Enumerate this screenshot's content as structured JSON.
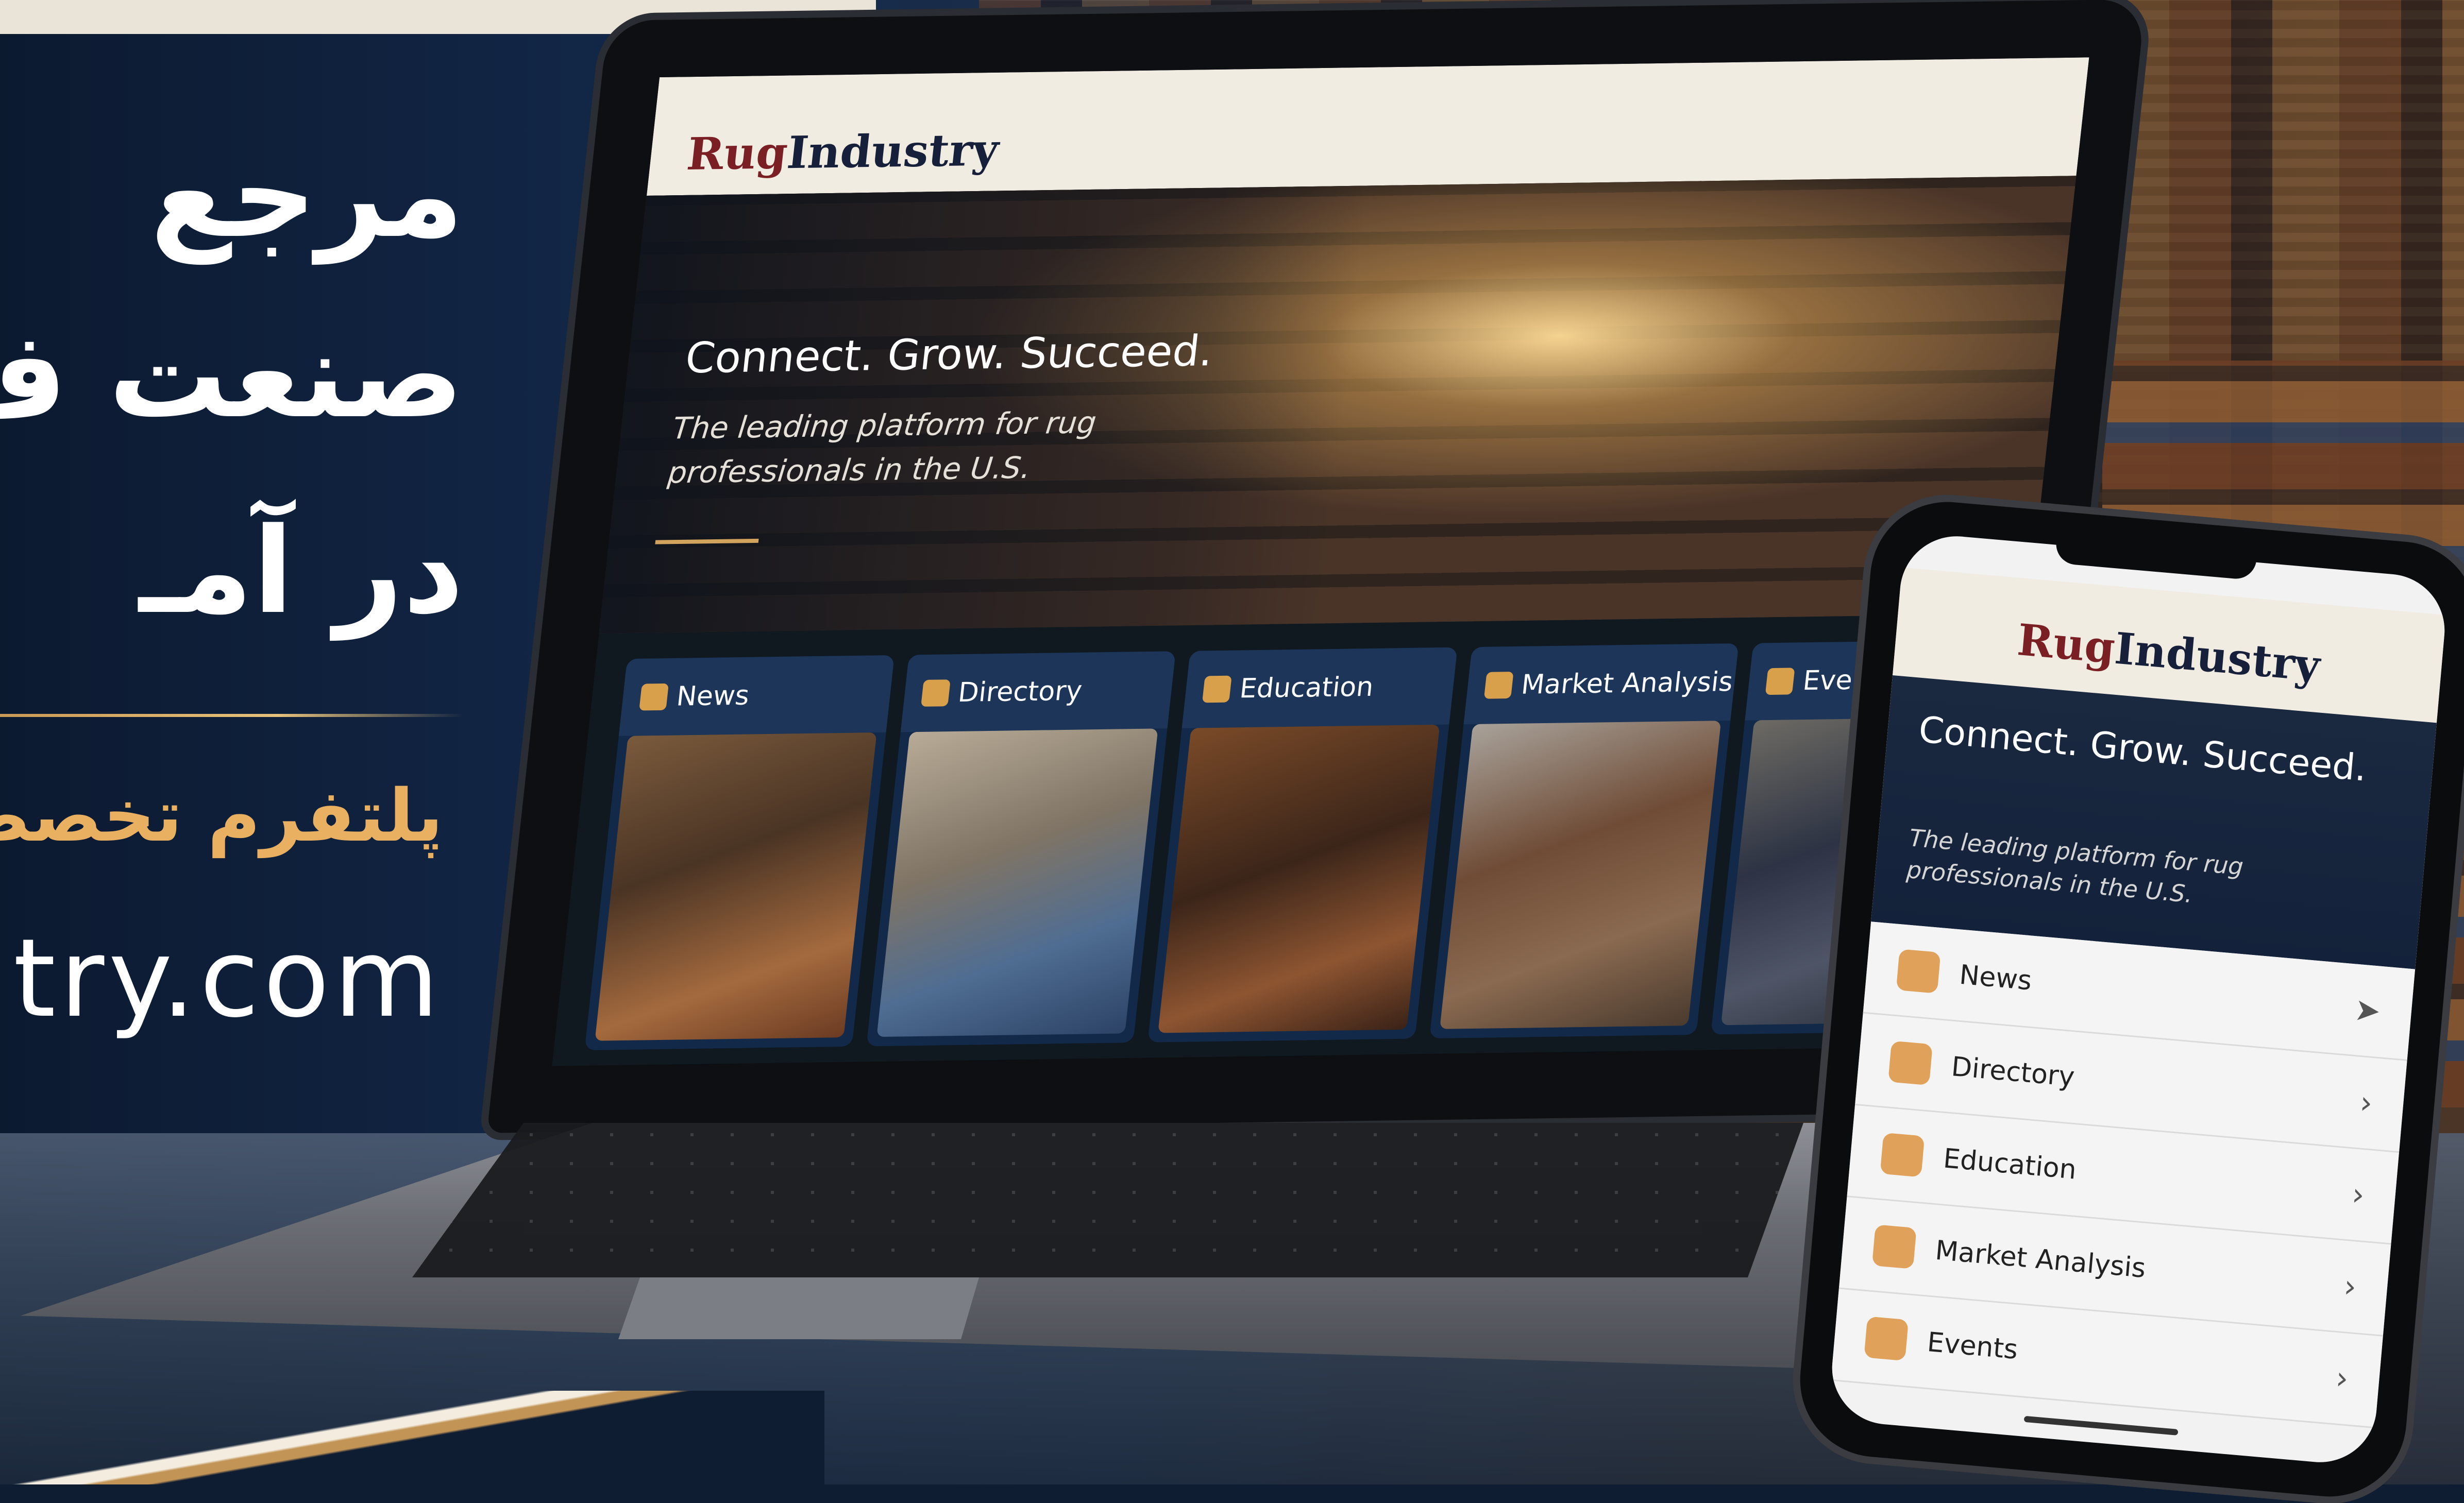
{
  "headline": {
    "line1": "مرجع",
    "line2": "صنعت ف",
    "line3": "در آمـ",
    "subtitle": "پلتفرم تخصص",
    "url": "try.com"
  },
  "laptop": {
    "logo_part1": "Rug",
    "logo_part2": "Industry",
    "hero_title": "Connect. Grow. Succeed.",
    "hero_subtitle": "The leading platform for rug professionals in the U.S.",
    "cards": [
      {
        "label": "News",
        "icon": "newspaper-icon"
      },
      {
        "label": "Directory",
        "icon": "building-icon"
      },
      {
        "label": "Education",
        "icon": "trophy-icon"
      },
      {
        "label": "Market Analysis",
        "icon": "bar-chart-icon"
      },
      {
        "label": "Events",
        "icon": "calendar-icon"
      }
    ]
  },
  "phone": {
    "logo_part1": "Rug",
    "logo_part2": "Industry",
    "hero_title": "Connect. Grow. Succeed.",
    "hero_subtitle": "The leading platform for rug professionals in the U.S.",
    "menu": [
      {
        "label": "News",
        "icon": "newspaper-icon"
      },
      {
        "label": "Directory",
        "icon": "building-icon"
      },
      {
        "label": "Education",
        "icon": "lightbulb-icon"
      },
      {
        "label": "Market Analysis",
        "icon": "bar-chart-icon"
      },
      {
        "label": "Events",
        "icon": "calendar-icon"
      }
    ]
  },
  "colors": {
    "accent_gold": "#d9a04b",
    "navy": "#13294a",
    "logo_red": "#7a1f24"
  }
}
